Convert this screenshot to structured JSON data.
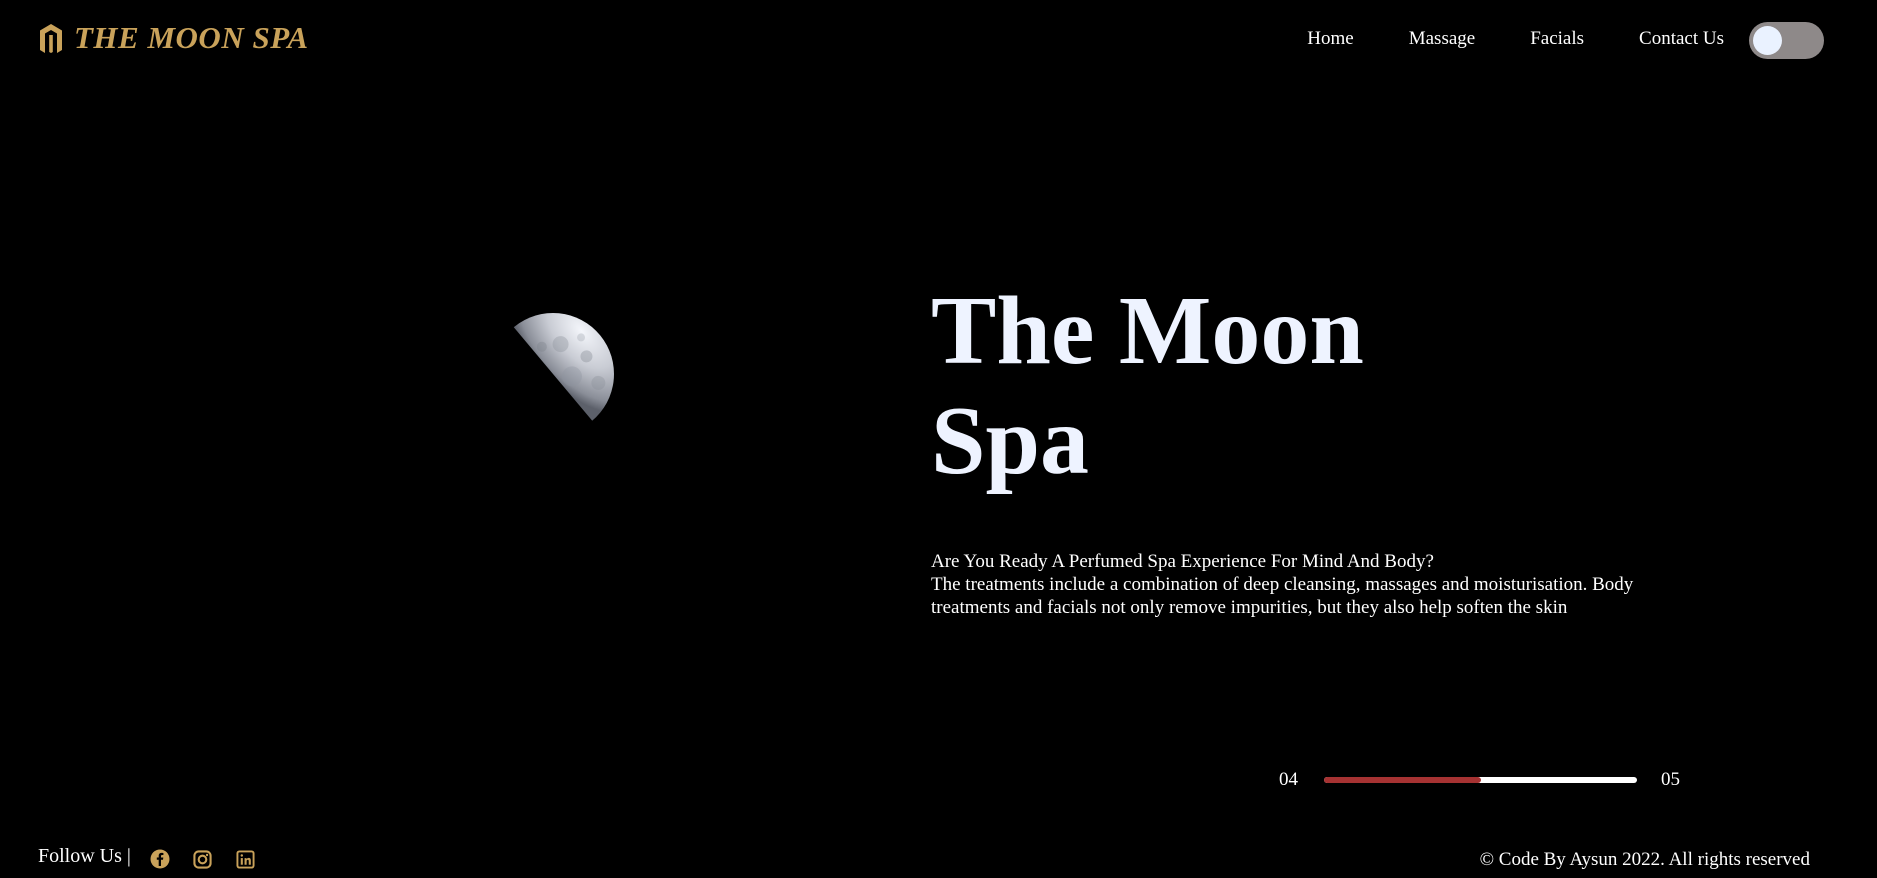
{
  "brand": {
    "name": "THE MOON SPA",
    "logo_icon": "magento-like-hexagon-logo-icon",
    "color": "#c9a25a"
  },
  "nav": {
    "items": [
      {
        "label": "Home"
      },
      {
        "label": "Massage"
      },
      {
        "label": "Facials"
      },
      {
        "label": "Contact Us"
      }
    ]
  },
  "theme_toggle": {
    "state": "off",
    "track_color": "#8e8989",
    "knob_color": "#eaf2ff"
  },
  "hero": {
    "title": "The Moon Spa",
    "subtitle": "Are You Ready A Perfumed Spa Experience For Mind And Body?",
    "description": "The treatments include a combination of deep cleansing, massages and moisturisation. Body treatments and facials not only remove impurities, but they also help soften the skin",
    "image": "half-moon-image"
  },
  "slider": {
    "current": "04",
    "total": "05",
    "progress": 0.5,
    "fill_color": "#a63232",
    "track_color": "#ffffff"
  },
  "footer": {
    "follow_label": "Follow Us |",
    "social": [
      {
        "icon": "facebook-icon"
      },
      {
        "icon": "instagram-icon"
      },
      {
        "icon": "linkedin-icon"
      }
    ],
    "social_color": "#c9a25a",
    "copyright": "© Code By Aysun 2022. All rights reserved"
  }
}
